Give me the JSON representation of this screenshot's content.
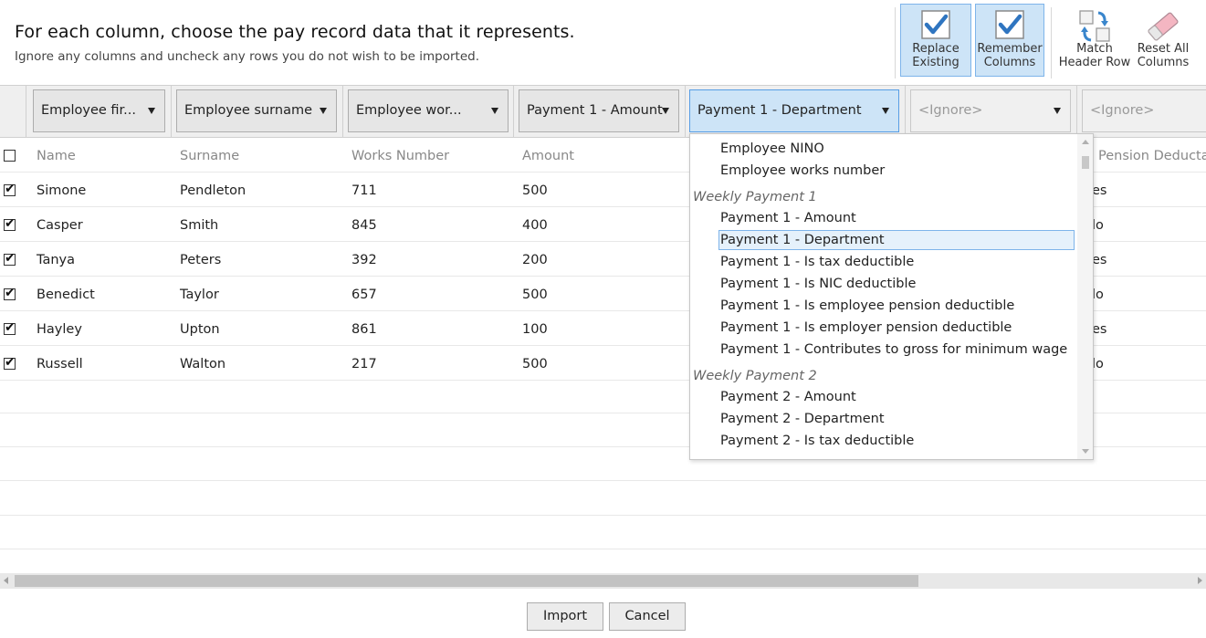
{
  "header": {
    "title": "For each column, choose the pay record data that it represents.",
    "subtitle": "Ignore any columns and uncheck any rows you do not wish to be imported."
  },
  "toolbar": {
    "replace_existing": [
      "Replace",
      "Existing"
    ],
    "remember_columns": [
      "Remember",
      "Columns"
    ],
    "match_header_row": [
      "Match",
      "Header Row"
    ],
    "reset_all_columns": [
      "Reset All",
      "Columns"
    ]
  },
  "column_selectors": [
    "Employee fir...",
    "Employee surname",
    "Employee wor...",
    "Payment 1 - Amount",
    "Payment 1 - Department",
    "<Ignore>",
    "<Ignore>"
  ],
  "table": {
    "headers": [
      "Name",
      "Surname",
      "Works Number",
      "Amount",
      "Pension Deductab"
    ],
    "rows": [
      {
        "checked": true,
        "name": "Simone",
        "surname": "Pendleton",
        "works": "711",
        "amount": "500",
        "pension": "es"
      },
      {
        "checked": true,
        "name": "Casper",
        "surname": "Smith",
        "works": "845",
        "amount": "400",
        "pension": "lo"
      },
      {
        "checked": true,
        "name": "Tanya",
        "surname": "Peters",
        "works": "392",
        "amount": "200",
        "pension": "es"
      },
      {
        "checked": true,
        "name": "Benedict",
        "surname": "Taylor",
        "works": "657",
        "amount": "500",
        "pension": "lo"
      },
      {
        "checked": true,
        "name": "Hayley",
        "surname": "Upton",
        "works": "861",
        "amount": "100",
        "pension": "es"
      },
      {
        "checked": true,
        "name": "Russell",
        "surname": "Walton",
        "works": "217",
        "amount": "500",
        "pension": "lo"
      }
    ]
  },
  "dropdown": {
    "items": [
      {
        "type": "item",
        "label": "Employee NINO"
      },
      {
        "type": "item",
        "label": "Employee works number"
      },
      {
        "type": "group",
        "label": "Weekly Payment 1"
      },
      {
        "type": "item",
        "label": "Payment 1 - Amount"
      },
      {
        "type": "item",
        "label": "Payment 1 - Department",
        "selected": true
      },
      {
        "type": "item",
        "label": "Payment 1 - Is tax deductible"
      },
      {
        "type": "item",
        "label": "Payment 1 - Is NIC deductible"
      },
      {
        "type": "item",
        "label": "Payment 1 - Is employee pension deductible"
      },
      {
        "type": "item",
        "label": "Payment 1 - Is employer pension deductible"
      },
      {
        "type": "item",
        "label": "Payment 1 - Contributes to gross for minimum wage"
      },
      {
        "type": "group",
        "label": "Weekly Payment 2"
      },
      {
        "type": "item",
        "label": "Payment 2 - Amount"
      },
      {
        "type": "item",
        "label": "Payment 2 - Department"
      },
      {
        "type": "item",
        "label": "Payment 2 - Is tax deductible"
      }
    ]
  },
  "buttons": {
    "import": "Import",
    "cancel": "Cancel"
  },
  "colors": {
    "toggle_active_bg": "#cde4f7",
    "toggle_active_border": "#7eb4ea",
    "check_blue": "#2f75c0"
  }
}
